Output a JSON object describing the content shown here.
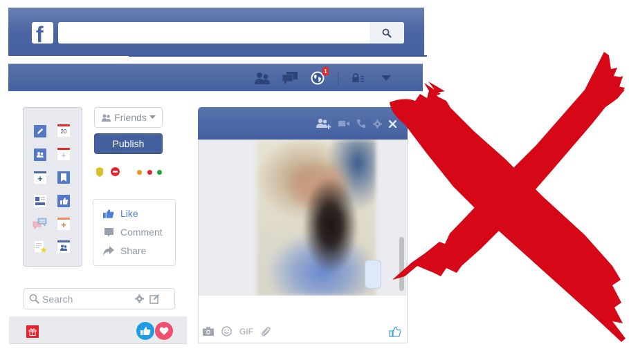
{
  "header": {
    "logo": "f",
    "search_value": "",
    "search_placeholder": ""
  },
  "navbar": {
    "icons": [
      "friend-requests-icon",
      "messages-icon",
      "notifications-globe-icon",
      "privacy-lock-icon",
      "account-dropdown-icon"
    ],
    "notification_count": "1"
  },
  "icon_panel": {
    "calendar_date": "20",
    "icons": [
      "edit-pencil-icon",
      "calendar-event-icon",
      "groups-icon",
      "calendar-add-icon",
      "add-page-icon",
      "bookmark-icon",
      "news-feed-icon",
      "like-page-icon",
      "chat-bubbles-icon",
      "event-add-icon",
      "favorites-star-icon",
      "group-page-icon"
    ]
  },
  "audience": {
    "label": "Friends"
  },
  "publish": {
    "label": "Publish"
  },
  "status": {
    "colors": {
      "badge": "#d6c32a",
      "blocked": "#e8212e",
      "orange": "#f29219",
      "red": "#e8212e",
      "green": "#1ba634"
    }
  },
  "actions": {
    "like": "Like",
    "comment": "Comment",
    "share": "Share"
  },
  "left_search": {
    "placeholder": "Search",
    "value": ""
  },
  "chat": {
    "header_icons": [
      "add-friend-icon",
      "video-call-icon",
      "voice-call-icon",
      "settings-gear-icon",
      "close-icon"
    ],
    "message_placeholder": "",
    "footer": {
      "gif_label": "GIF"
    }
  },
  "colors": {
    "brand_blue": "#4866a5",
    "like_blue": "#4c7ee0",
    "reaction_like": "#1f9be3",
    "reaction_love": "#f0506e",
    "red_x": "#d60716"
  }
}
